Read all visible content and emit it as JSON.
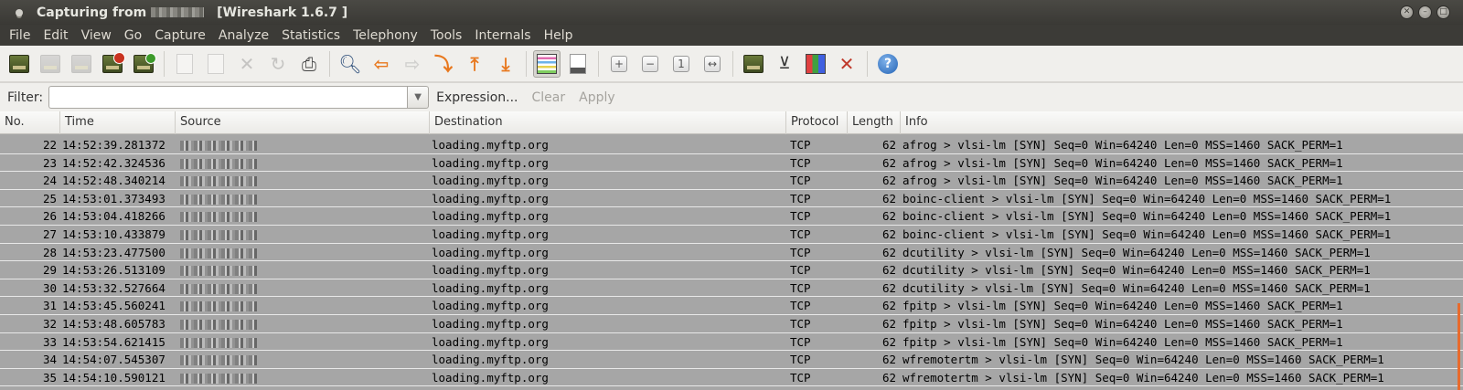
{
  "window": {
    "title_prefix": "Capturing from",
    "title_suffix": "[Wireshark 1.6.7 ]",
    "buttons": [
      "✕",
      "–",
      "□"
    ]
  },
  "menu": [
    "File",
    "Edit",
    "View",
    "Go",
    "Capture",
    "Analyze",
    "Statistics",
    "Telephony",
    "Tools",
    "Internals",
    "Help"
  ],
  "toolbar": {
    "icons": [
      "interface-list-icon",
      "capture-options-icon",
      "start-capture-icon",
      "stop-capture-icon",
      "restart-capture-icon",
      "open-file-icon",
      "save-file-icon",
      "close-file-icon",
      "reload-icon",
      "print-icon",
      "find-packet-icon",
      "go-back-icon",
      "go-forward-icon",
      "go-to-packet-icon",
      "go-first-icon",
      "go-last-icon",
      "colorize-icon",
      "auto-scroll-icon",
      "zoom-in-icon",
      "zoom-out-icon",
      "normal-size-icon",
      "resize-columns-icon",
      "capture-filters-icon",
      "display-filters-icon",
      "coloring-rules-icon",
      "preferences-icon",
      "help-icon"
    ]
  },
  "filter": {
    "label": "Filter:",
    "value": "",
    "expression_label": "Expression...",
    "clear_label": "Clear",
    "apply_label": "Apply"
  },
  "columns": [
    "No.",
    "Time",
    "Source",
    "Destination",
    "Protocol",
    "Length",
    "Info"
  ],
  "packets": [
    {
      "no": "22",
      "time": "14:52:39.281372",
      "dst": "loading.myftp.org",
      "proto": "TCP",
      "len": "62",
      "info": "afrog > vlsi-lm [SYN] Seq=0 Win=64240 Len=0 MSS=1460 SACK_PERM=1"
    },
    {
      "no": "23",
      "time": "14:52:42.324536",
      "dst": "loading.myftp.org",
      "proto": "TCP",
      "len": "62",
      "info": "afrog > vlsi-lm [SYN] Seq=0 Win=64240 Len=0 MSS=1460 SACK_PERM=1"
    },
    {
      "no": "24",
      "time": "14:52:48.340214",
      "dst": "loading.myftp.org",
      "proto": "TCP",
      "len": "62",
      "info": "afrog > vlsi-lm [SYN] Seq=0 Win=64240 Len=0 MSS=1460 SACK_PERM=1"
    },
    {
      "no": "25",
      "time": "14:53:01.373493",
      "dst": "loading.myftp.org",
      "proto": "TCP",
      "len": "62",
      "info": "boinc-client > vlsi-lm [SYN] Seq=0 Win=64240 Len=0 MSS=1460 SACK_PERM=1"
    },
    {
      "no": "26",
      "time": "14:53:04.418266",
      "dst": "loading.myftp.org",
      "proto": "TCP",
      "len": "62",
      "info": "boinc-client > vlsi-lm [SYN] Seq=0 Win=64240 Len=0 MSS=1460 SACK_PERM=1"
    },
    {
      "no": "27",
      "time": "14:53:10.433879",
      "dst": "loading.myftp.org",
      "proto": "TCP",
      "len": "62",
      "info": "boinc-client > vlsi-lm [SYN] Seq=0 Win=64240 Len=0 MSS=1460 SACK_PERM=1"
    },
    {
      "no": "28",
      "time": "14:53:23.477500",
      "dst": "loading.myftp.org",
      "proto": "TCP",
      "len": "62",
      "info": "dcutility > vlsi-lm [SYN] Seq=0 Win=64240 Len=0 MSS=1460 SACK_PERM=1"
    },
    {
      "no": "29",
      "time": "14:53:26.513109",
      "dst": "loading.myftp.org",
      "proto": "TCP",
      "len": "62",
      "info": "dcutility > vlsi-lm [SYN] Seq=0 Win=64240 Len=0 MSS=1460 SACK_PERM=1"
    },
    {
      "no": "30",
      "time": "14:53:32.527664",
      "dst": "loading.myftp.org",
      "proto": "TCP",
      "len": "62",
      "info": "dcutility > vlsi-lm [SYN] Seq=0 Win=64240 Len=0 MSS=1460 SACK_PERM=1"
    },
    {
      "no": "31",
      "time": "14:53:45.560241",
      "dst": "loading.myftp.org",
      "proto": "TCP",
      "len": "62",
      "info": "fpitp > vlsi-lm [SYN] Seq=0 Win=64240 Len=0 MSS=1460 SACK_PERM=1"
    },
    {
      "no": "32",
      "time": "14:53:48.605783",
      "dst": "loading.myftp.org",
      "proto": "TCP",
      "len": "62",
      "info": "fpitp > vlsi-lm [SYN] Seq=0 Win=64240 Len=0 MSS=1460 SACK_PERM=1"
    },
    {
      "no": "33",
      "time": "14:53:54.621415",
      "dst": "loading.myftp.org",
      "proto": "TCP",
      "len": "62",
      "info": "fpitp > vlsi-lm [SYN] Seq=0 Win=64240 Len=0 MSS=1460 SACK_PERM=1"
    },
    {
      "no": "34",
      "time": "14:54:07.545307",
      "dst": "loading.myftp.org",
      "proto": "TCP",
      "len": "62",
      "info": "wfremotertm > vlsi-lm [SYN] Seq=0 Win=64240 Len=0 MSS=1460 SACK_PERM=1"
    },
    {
      "no": "35",
      "time": "14:54:10.590121",
      "dst": "loading.myftp.org",
      "proto": "TCP",
      "len": "62",
      "info": "wfremotertm > vlsi-lm [SYN] Seq=0 Win=64240 Len=0 MSS=1460 SACK_PERM=1"
    }
  ]
}
